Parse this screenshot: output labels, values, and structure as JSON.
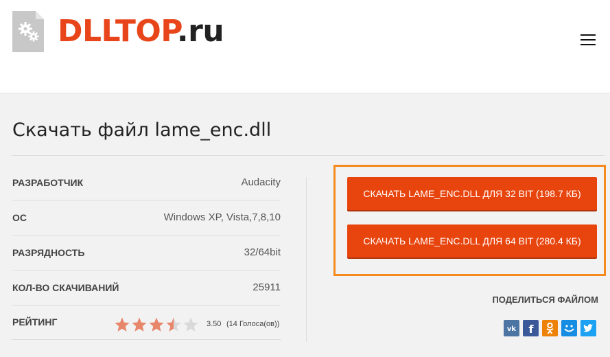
{
  "header": {
    "logo_brand": "DLLTOP",
    "logo_tld": ".ru"
  },
  "page": {
    "title": "Скачать файл lame_enc.dll"
  },
  "info": [
    {
      "label": "РАЗРАБОТЧИК",
      "value": "Audacity"
    },
    {
      "label": "ОС",
      "value": "Windows XP, Vista,7,8,10"
    },
    {
      "label": "РАЗРЯДНОСТЬ",
      "value": "32/64bit"
    },
    {
      "label": "КОЛ-ВО СКАЧИВАНИЙ",
      "value": "25911"
    },
    {
      "label": "РЕЙТИНГ",
      "value": ""
    }
  ],
  "rating": {
    "score": "3.50",
    "votes": "(14 Голоса(ов))",
    "stars_value": 3.5,
    "stars_max": 5,
    "star_color": "#e8866a",
    "star_empty_color": "#d9d9d9"
  },
  "downloads": {
    "btn_32": "СКАЧАТЬ LAME_ENC.DLL ДЛЯ 32 BIT (198.7 КБ)",
    "btn_64": "СКАЧАТЬ LAME_ENC.DLL ДЛЯ 64 BIT (280.4 КБ)",
    "button_color": "#e8450e",
    "highlight_color": "#f58a1f"
  },
  "share": {
    "label": "ПОДЕЛИТЬСЯ ФАЙЛОМ",
    "icons": [
      {
        "name": "vk-icon",
        "color": "#4c75a3"
      },
      {
        "name": "facebook-icon",
        "color": "#3b5998"
      },
      {
        "name": "odnoklassniki-icon",
        "color": "#ee8208"
      },
      {
        "name": "moimir-icon",
        "color": "#168de2"
      },
      {
        "name": "twitter-icon",
        "color": "#1da1f2"
      }
    ]
  },
  "colors": {
    "brand": "#e8461a",
    "background": "#f2f2f2"
  }
}
